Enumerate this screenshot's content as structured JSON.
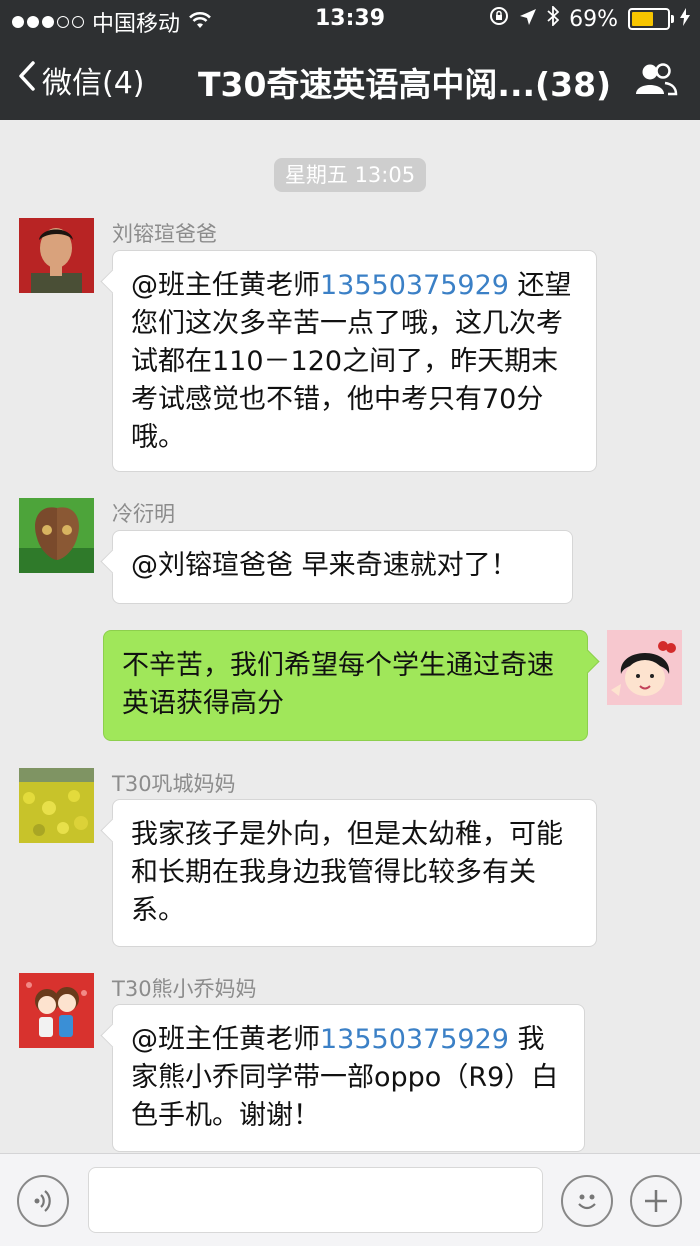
{
  "status_bar": {
    "carrier": "中国移动",
    "time": "13:39",
    "battery": "69%",
    "battery_level": 0.69,
    "signal_bars": 3,
    "signal_total": 5
  },
  "nav": {
    "back_label": "微信(4)",
    "title": "T30奇速英语高中阅...(38)",
    "members_icon": "group-members-icon"
  },
  "chat": {
    "timestamp": "星期五 13:05",
    "messages": [
      {
        "sender": "刘镕瑄爸爸",
        "mention": "@班主任黄老师",
        "phone": "13550375929",
        "text": " 还望您们这次多辛苦一点了哦，这几次考试都在110－120之间了，昨天期末考试感觉也不错，他中考只有70分哦。"
      },
      {
        "sender": "冷衍明",
        "text": "@刘镕瑄爸爸 早来奇速就对了！"
      },
      {
        "sender": "",
        "mine": true,
        "text": "不辛苦，我们希望每个学生通过奇速英语获得高分"
      },
      {
        "sender": "T30巩城妈妈",
        "text": "我家孩子是外向，但是太幼稚，可能和长期在我身边我管得比较多有关系。"
      },
      {
        "sender": "T30熊小乔妈妈",
        "mention": "@班主任黄老师",
        "phone": "13550375929",
        "text": " 我家熊小乔同学带一部oppo（R9）白色手机。谢谢！"
      }
    ]
  },
  "input_bar": {
    "voice_icon": "voice-icon",
    "emoji_icon": "emoji-icon",
    "plus_icon": "plus-icon"
  },
  "colors": {
    "bar": "#2e3032",
    "background": "#ebebeb",
    "my_bubble": "#a0e75a",
    "link": "#3b80c6"
  }
}
